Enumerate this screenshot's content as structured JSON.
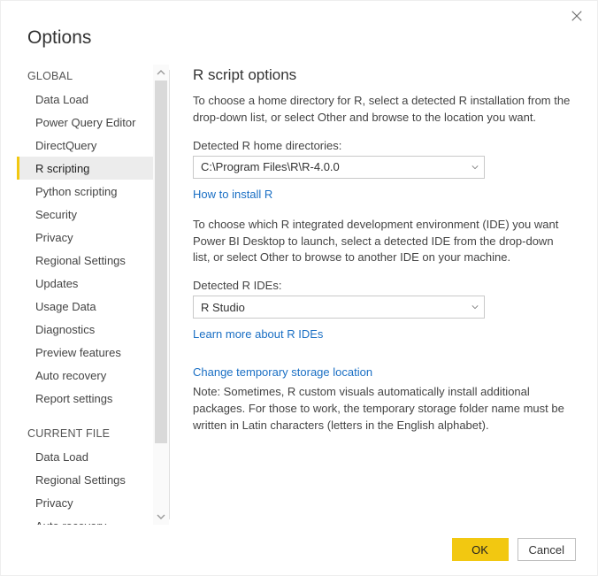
{
  "dialog": {
    "title": "Options"
  },
  "sidebar": {
    "sections": [
      {
        "header": "GLOBAL",
        "items": [
          {
            "label": "Data Load",
            "selected": false
          },
          {
            "label": "Power Query Editor",
            "selected": false
          },
          {
            "label": "DirectQuery",
            "selected": false
          },
          {
            "label": "R scripting",
            "selected": true
          },
          {
            "label": "Python scripting",
            "selected": false
          },
          {
            "label": "Security",
            "selected": false
          },
          {
            "label": "Privacy",
            "selected": false
          },
          {
            "label": "Regional Settings",
            "selected": false
          },
          {
            "label": "Updates",
            "selected": false
          },
          {
            "label": "Usage Data",
            "selected": false
          },
          {
            "label": "Diagnostics",
            "selected": false
          },
          {
            "label": "Preview features",
            "selected": false
          },
          {
            "label": "Auto recovery",
            "selected": false
          },
          {
            "label": "Report settings",
            "selected": false
          }
        ]
      },
      {
        "header": "CURRENT FILE",
        "items": [
          {
            "label": "Data Load",
            "selected": false
          },
          {
            "label": "Regional Settings",
            "selected": false
          },
          {
            "label": "Privacy",
            "selected": false
          },
          {
            "label": "Auto recovery",
            "selected": false
          }
        ]
      }
    ]
  },
  "content": {
    "heading": "R script options",
    "intro": "To choose a home directory for R, select a detected R installation from the drop-down list, or select Other and browse to the location you want.",
    "home_label": "Detected R home directories:",
    "home_value": "C:\\Program Files\\R\\R-4.0.0",
    "install_link": "How to install R",
    "ide_intro": "To choose which R integrated development environment (IDE) you want Power BI Desktop to launch, select a detected IDE from the drop-down list, or select Other to browse to another IDE on your machine.",
    "ide_label": "Detected R IDEs:",
    "ide_value": "R Studio",
    "ide_link": "Learn more about R IDEs",
    "temp_link": "Change temporary storage location",
    "note": "Note: Sometimes, R custom visuals automatically install additional packages. For those to work, the temporary storage folder name must be written in Latin characters (letters in the English alphabet)."
  },
  "footer": {
    "ok": "OK",
    "cancel": "Cancel"
  }
}
